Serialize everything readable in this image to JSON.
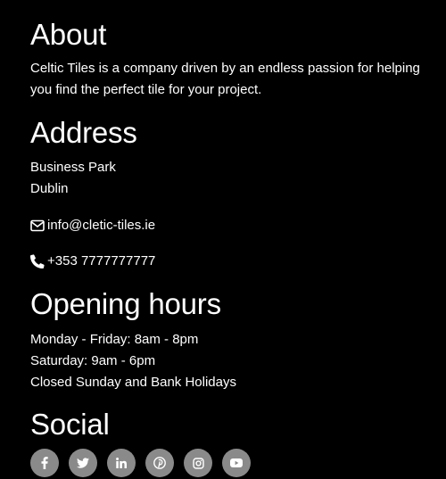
{
  "about": {
    "heading": "About",
    "text": "Celtic Tiles is a company driven by an endless passion for helping you find the perfect tile for your project."
  },
  "address": {
    "heading": "Address",
    "line1": "Business Park",
    "line2": "Dublin",
    "email": "info@cletic-tiles.ie",
    "phone": "+353 7777777777",
    "icons": [
      "envelope-icon",
      "phone-icon"
    ]
  },
  "hours": {
    "heading": "Opening hours",
    "line1": "Monday - Friday: 8am - 8pm",
    "line2": "Saturday: 9am - 6pm",
    "line3": "Closed Sunday and Bank Holidays"
  },
  "social": {
    "heading": "Social",
    "icons": [
      "facebook-icon",
      "twitter-icon",
      "linkedin-icon",
      "pinterest-icon",
      "instagram-icon",
      "youtube-icon"
    ],
    "button_color": "#8a8a8a"
  },
  "colors": {
    "background": "#000000",
    "text": "#ffffff"
  }
}
